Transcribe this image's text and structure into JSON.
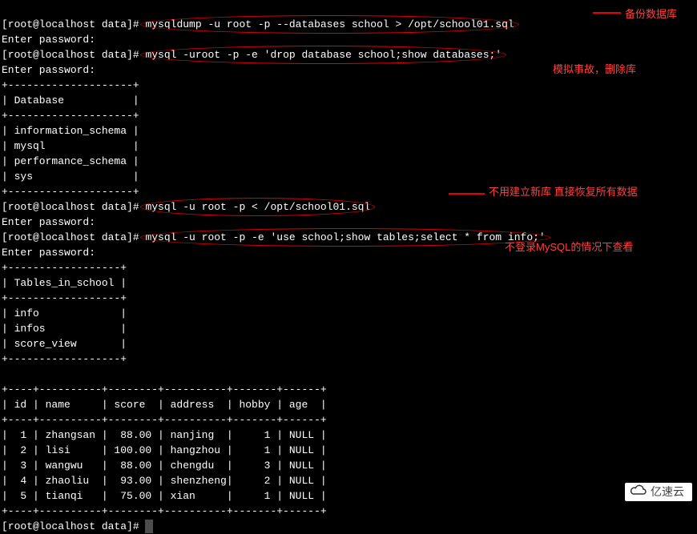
{
  "prompt": "[root@localhost data]# ",
  "cmds": {
    "dump": "mysqldump -u root -p --databases school > /opt/school01.sql",
    "drop": "mysql -uroot -p -e 'drop database school;show databases;'",
    "restore": "mysql -u root -p < /opt/school01.sql",
    "verify": "mysql -u root -p -e 'use school;show tables;select * from info;'"
  },
  "pw": "Enter password: ",
  "annotations": {
    "a1": "备份数据库",
    "a2": "模拟事故，删除库",
    "a3": "不用建立新库 直接恢复所有数据",
    "a4": "不登录MySQL的情况下查看"
  },
  "db_sep": "+--------------------+",
  "db_header": "| Database           |",
  "db_rows": [
    "| information_schema |",
    "| mysql              |",
    "| performance_schema |",
    "| sys                |"
  ],
  "tbl_sep": "+------------------+",
  "tbl_header": "| Tables_in_school |",
  "tbl_rows": [
    "| info             |",
    "| infos            |",
    "| score_view       |"
  ],
  "info_sep": "+----+----------+--------+----------+-------+------+",
  "info_header": "| id | name     | score  | address  | hobby | age  |",
  "info_rows": [
    "|  1 | zhangsan |  88.00 | nanjing  |     1 | NULL |",
    "|  2 | lisi     | 100.00 | hangzhou |     1 | NULL |",
    "|  3 | wangwu   |  88.00 | chengdu  |     3 | NULL |",
    "|  4 | zhaoliu  |  93.00 | shenzheng|     2 | NULL |",
    "|  5 | tianqi   |  75.00 | xian     |     1 | NULL |"
  ],
  "logo_text": "亿速云",
  "chart_data": {
    "type": "table",
    "title": "info",
    "columns": [
      "id",
      "name",
      "score",
      "address",
      "hobby",
      "age"
    ],
    "rows": [
      [
        1,
        "zhangsan",
        88.0,
        "nanjing",
        1,
        null
      ],
      [
        2,
        "lisi",
        100.0,
        "hangzhou",
        1,
        null
      ],
      [
        3,
        "wangwu",
        88.0,
        "chengdu",
        3,
        null
      ],
      [
        4,
        "zhaoliu",
        93.0,
        "shenzheng",
        2,
        null
      ],
      [
        5,
        "tianqi",
        75.0,
        "xian",
        1,
        null
      ]
    ]
  }
}
